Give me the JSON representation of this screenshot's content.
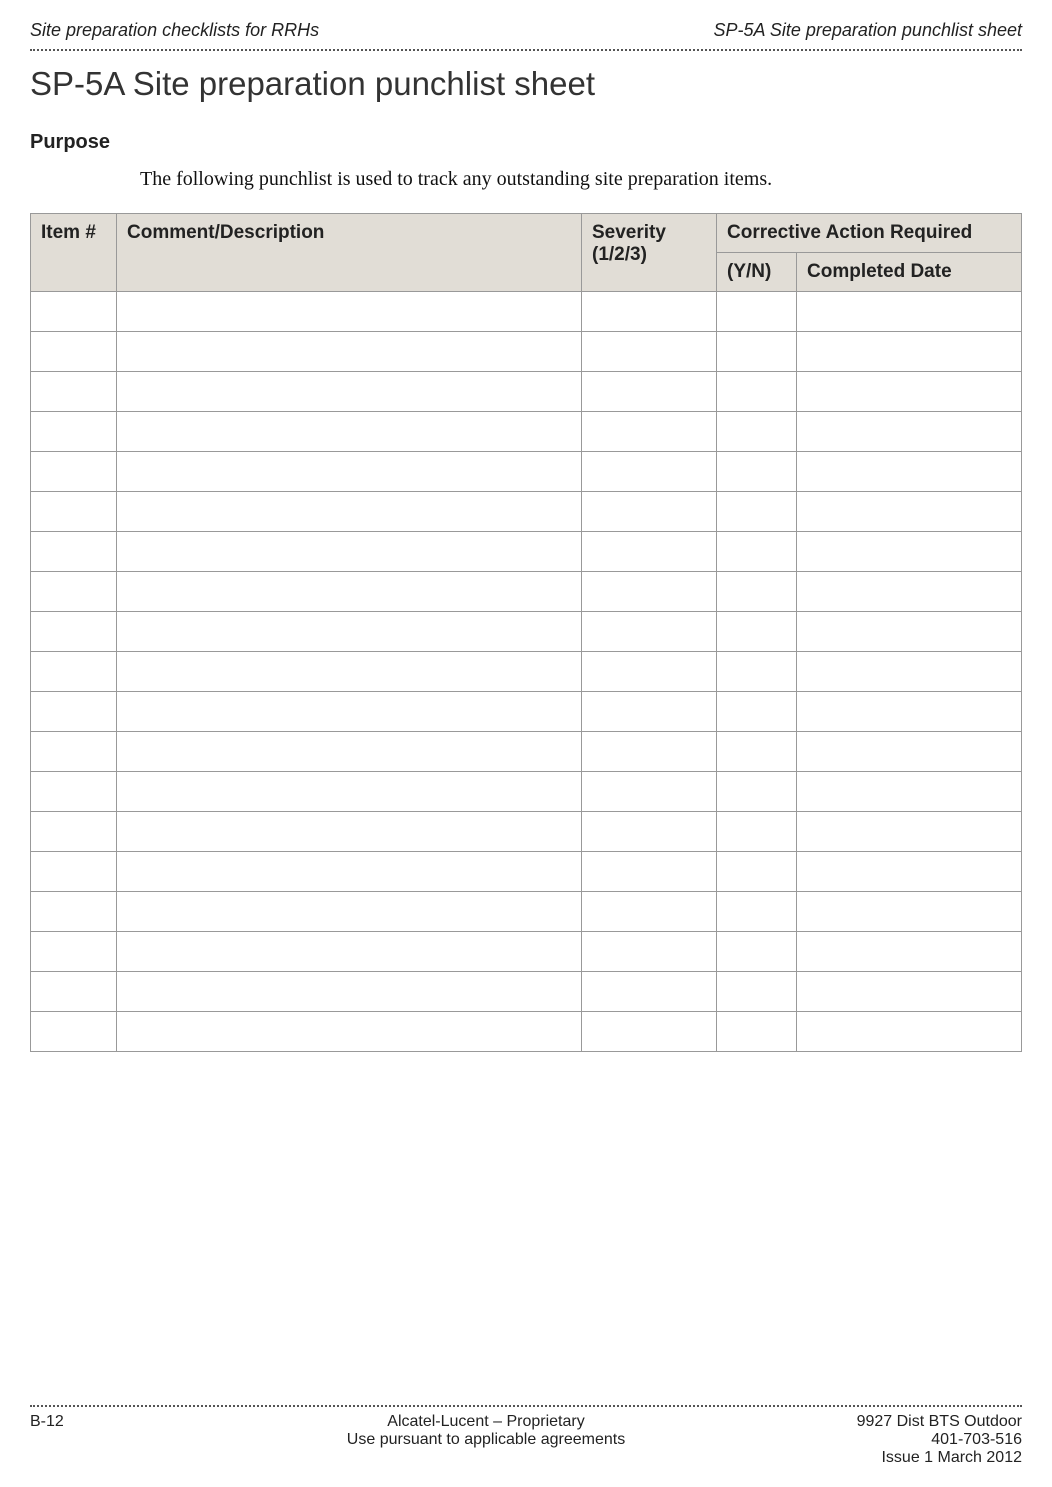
{
  "header": {
    "left": "Site preparation checklists for RRHs",
    "right": "SP-5A Site preparation punchlist sheet"
  },
  "title": "SP-5A Site preparation punchlist sheet",
  "purpose": {
    "heading": "Purpose",
    "text": "The following punchlist is used to track any outstanding site preparation items."
  },
  "table": {
    "headers": {
      "item": "Item #",
      "comment": "Comment/Description",
      "severity": "Severity (1/2/3)",
      "corrective": "Corrective Action Required",
      "yn": "(Y/N)",
      "date": "Completed Date"
    },
    "rows": [
      {
        "item": "",
        "comment": "",
        "severity": "",
        "yn": "",
        "date": ""
      },
      {
        "item": "",
        "comment": "",
        "severity": "",
        "yn": "",
        "date": ""
      },
      {
        "item": "",
        "comment": "",
        "severity": "",
        "yn": "",
        "date": ""
      },
      {
        "item": "",
        "comment": "",
        "severity": "",
        "yn": "",
        "date": ""
      },
      {
        "item": "",
        "comment": "",
        "severity": "",
        "yn": "",
        "date": ""
      },
      {
        "item": "",
        "comment": "",
        "severity": "",
        "yn": "",
        "date": ""
      },
      {
        "item": "",
        "comment": "",
        "severity": "",
        "yn": "",
        "date": ""
      },
      {
        "item": "",
        "comment": "",
        "severity": "",
        "yn": "",
        "date": ""
      },
      {
        "item": "",
        "comment": "",
        "severity": "",
        "yn": "",
        "date": ""
      },
      {
        "item": "",
        "comment": "",
        "severity": "",
        "yn": "",
        "date": ""
      },
      {
        "item": "",
        "comment": "",
        "severity": "",
        "yn": "",
        "date": ""
      },
      {
        "item": "",
        "comment": "",
        "severity": "",
        "yn": "",
        "date": ""
      },
      {
        "item": "",
        "comment": "",
        "severity": "",
        "yn": "",
        "date": ""
      },
      {
        "item": "",
        "comment": "",
        "severity": "",
        "yn": "",
        "date": ""
      },
      {
        "item": "",
        "comment": "",
        "severity": "",
        "yn": "",
        "date": ""
      },
      {
        "item": "",
        "comment": "",
        "severity": "",
        "yn": "",
        "date": ""
      },
      {
        "item": "",
        "comment": "",
        "severity": "",
        "yn": "",
        "date": ""
      },
      {
        "item": "",
        "comment": "",
        "severity": "",
        "yn": "",
        "date": ""
      },
      {
        "item": "",
        "comment": "",
        "severity": "",
        "yn": "",
        "date": ""
      }
    ]
  },
  "footer": {
    "page": "B-12",
    "center1": "Alcatel-Lucent – Proprietary",
    "center2": "Use pursuant to applicable agreements",
    "right1": "9927 Dist BTS Outdoor",
    "right2": "401-703-516",
    "right3": "Issue 1   March 2012"
  }
}
